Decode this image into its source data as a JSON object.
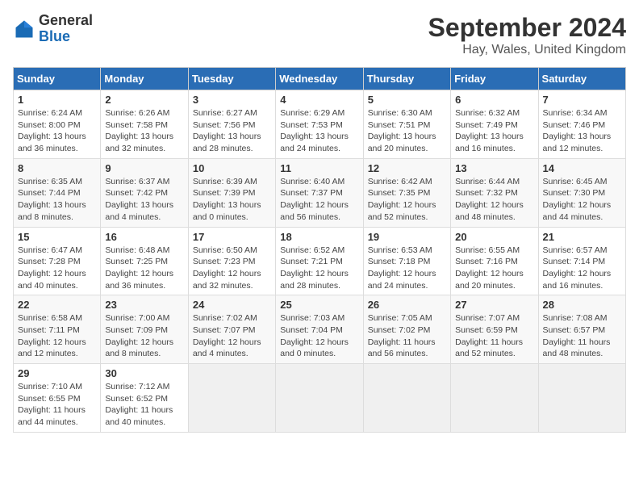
{
  "logo": {
    "text_general": "General",
    "text_blue": "Blue"
  },
  "title": "September 2024",
  "subtitle": "Hay, Wales, United Kingdom",
  "headers": [
    "Sunday",
    "Monday",
    "Tuesday",
    "Wednesday",
    "Thursday",
    "Friday",
    "Saturday"
  ],
  "weeks": [
    [
      {
        "day": "1",
        "detail": "Sunrise: 6:24 AM\nSunset: 8:00 PM\nDaylight: 13 hours\nand 36 minutes."
      },
      {
        "day": "2",
        "detail": "Sunrise: 6:26 AM\nSunset: 7:58 PM\nDaylight: 13 hours\nand 32 minutes."
      },
      {
        "day": "3",
        "detail": "Sunrise: 6:27 AM\nSunset: 7:56 PM\nDaylight: 13 hours\nand 28 minutes."
      },
      {
        "day": "4",
        "detail": "Sunrise: 6:29 AM\nSunset: 7:53 PM\nDaylight: 13 hours\nand 24 minutes."
      },
      {
        "day": "5",
        "detail": "Sunrise: 6:30 AM\nSunset: 7:51 PM\nDaylight: 13 hours\nand 20 minutes."
      },
      {
        "day": "6",
        "detail": "Sunrise: 6:32 AM\nSunset: 7:49 PM\nDaylight: 13 hours\nand 16 minutes."
      },
      {
        "day": "7",
        "detail": "Sunrise: 6:34 AM\nSunset: 7:46 PM\nDaylight: 13 hours\nand 12 minutes."
      }
    ],
    [
      {
        "day": "8",
        "detail": "Sunrise: 6:35 AM\nSunset: 7:44 PM\nDaylight: 13 hours\nand 8 minutes."
      },
      {
        "day": "9",
        "detail": "Sunrise: 6:37 AM\nSunset: 7:42 PM\nDaylight: 13 hours\nand 4 minutes."
      },
      {
        "day": "10",
        "detail": "Sunrise: 6:39 AM\nSunset: 7:39 PM\nDaylight: 13 hours\nand 0 minutes."
      },
      {
        "day": "11",
        "detail": "Sunrise: 6:40 AM\nSunset: 7:37 PM\nDaylight: 12 hours\nand 56 minutes."
      },
      {
        "day": "12",
        "detail": "Sunrise: 6:42 AM\nSunset: 7:35 PM\nDaylight: 12 hours\nand 52 minutes."
      },
      {
        "day": "13",
        "detail": "Sunrise: 6:44 AM\nSunset: 7:32 PM\nDaylight: 12 hours\nand 48 minutes."
      },
      {
        "day": "14",
        "detail": "Sunrise: 6:45 AM\nSunset: 7:30 PM\nDaylight: 12 hours\nand 44 minutes."
      }
    ],
    [
      {
        "day": "15",
        "detail": "Sunrise: 6:47 AM\nSunset: 7:28 PM\nDaylight: 12 hours\nand 40 minutes."
      },
      {
        "day": "16",
        "detail": "Sunrise: 6:48 AM\nSunset: 7:25 PM\nDaylight: 12 hours\nand 36 minutes."
      },
      {
        "day": "17",
        "detail": "Sunrise: 6:50 AM\nSunset: 7:23 PM\nDaylight: 12 hours\nand 32 minutes."
      },
      {
        "day": "18",
        "detail": "Sunrise: 6:52 AM\nSunset: 7:21 PM\nDaylight: 12 hours\nand 28 minutes."
      },
      {
        "day": "19",
        "detail": "Sunrise: 6:53 AM\nSunset: 7:18 PM\nDaylight: 12 hours\nand 24 minutes."
      },
      {
        "day": "20",
        "detail": "Sunrise: 6:55 AM\nSunset: 7:16 PM\nDaylight: 12 hours\nand 20 minutes."
      },
      {
        "day": "21",
        "detail": "Sunrise: 6:57 AM\nSunset: 7:14 PM\nDaylight: 12 hours\nand 16 minutes."
      }
    ],
    [
      {
        "day": "22",
        "detail": "Sunrise: 6:58 AM\nSunset: 7:11 PM\nDaylight: 12 hours\nand 12 minutes."
      },
      {
        "day": "23",
        "detail": "Sunrise: 7:00 AM\nSunset: 7:09 PM\nDaylight: 12 hours\nand 8 minutes."
      },
      {
        "day": "24",
        "detail": "Sunrise: 7:02 AM\nSunset: 7:07 PM\nDaylight: 12 hours\nand 4 minutes."
      },
      {
        "day": "25",
        "detail": "Sunrise: 7:03 AM\nSunset: 7:04 PM\nDaylight: 12 hours\nand 0 minutes."
      },
      {
        "day": "26",
        "detail": "Sunrise: 7:05 AM\nSunset: 7:02 PM\nDaylight: 11 hours\nand 56 minutes."
      },
      {
        "day": "27",
        "detail": "Sunrise: 7:07 AM\nSunset: 6:59 PM\nDaylight: 11 hours\nand 52 minutes."
      },
      {
        "day": "28",
        "detail": "Sunrise: 7:08 AM\nSunset: 6:57 PM\nDaylight: 11 hours\nand 48 minutes."
      }
    ],
    [
      {
        "day": "29",
        "detail": "Sunrise: 7:10 AM\nSunset: 6:55 PM\nDaylight: 11 hours\nand 44 minutes."
      },
      {
        "day": "30",
        "detail": "Sunrise: 7:12 AM\nSunset: 6:52 PM\nDaylight: 11 hours\nand 40 minutes."
      },
      {
        "day": "",
        "detail": ""
      },
      {
        "day": "",
        "detail": ""
      },
      {
        "day": "",
        "detail": ""
      },
      {
        "day": "",
        "detail": ""
      },
      {
        "day": "",
        "detail": ""
      }
    ]
  ]
}
